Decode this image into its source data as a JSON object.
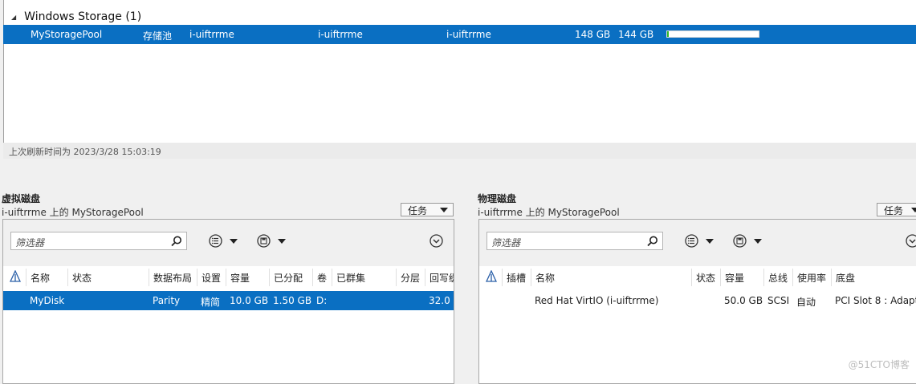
{
  "pool_group": {
    "label": "Windows Storage (1)"
  },
  "pool_row": {
    "name": "MyStoragePool",
    "status": "存储池",
    "server": "i-uiftrrme",
    "col4": "i-uiftrrme",
    "col5": "i-uiftrrme",
    "capacity": "148 GB",
    "free": "144 GB",
    "usage_fraction": 0.02
  },
  "refresh": {
    "text": "上次刷新时间为 2023/3/28 15:03:19"
  },
  "virtual_disks": {
    "title": "虚拟磁盘",
    "subtitle": "i-uiftrrme 上的 MyStoragePool",
    "tasks_label": "任务",
    "filter_placeholder": "筛选器",
    "columns": [
      "名称",
      "状态",
      "数据布局",
      "设置",
      "容量",
      "已分配",
      "卷",
      "已群集",
      "分层",
      "回写缓"
    ],
    "rows": [
      {
        "name": "MyDisk",
        "status": "",
        "layout": "Parity",
        "provisioning": "精简",
        "capacity": "10.0 GB",
        "allocated": "1.50 GB",
        "volume": "D:",
        "clustered": "",
        "tiered": "",
        "writeback": "32.0 I"
      }
    ]
  },
  "physical_disks": {
    "title": "物理磁盘",
    "subtitle": "i-uiftrrme 上的 MyStoragePool",
    "tasks_label": "任务",
    "filter_placeholder": "筛选器",
    "columns": [
      "插槽",
      "名称",
      "状态",
      "容量",
      "总线",
      "使用率",
      "底盘"
    ],
    "rows": [
      {
        "slot": "",
        "name": "Red Hat VirtIO (i-uiftrrme)",
        "status": "",
        "capacity": "50.0 GB",
        "bus": "SCSI",
        "usage": "自动",
        "chassis": "PCI Slot 8 : Adapt"
      }
    ]
  },
  "watermark": "@51CTO博客",
  "colors": {
    "selection": "#0a6fc2",
    "usage_fill": "#2db928"
  }
}
